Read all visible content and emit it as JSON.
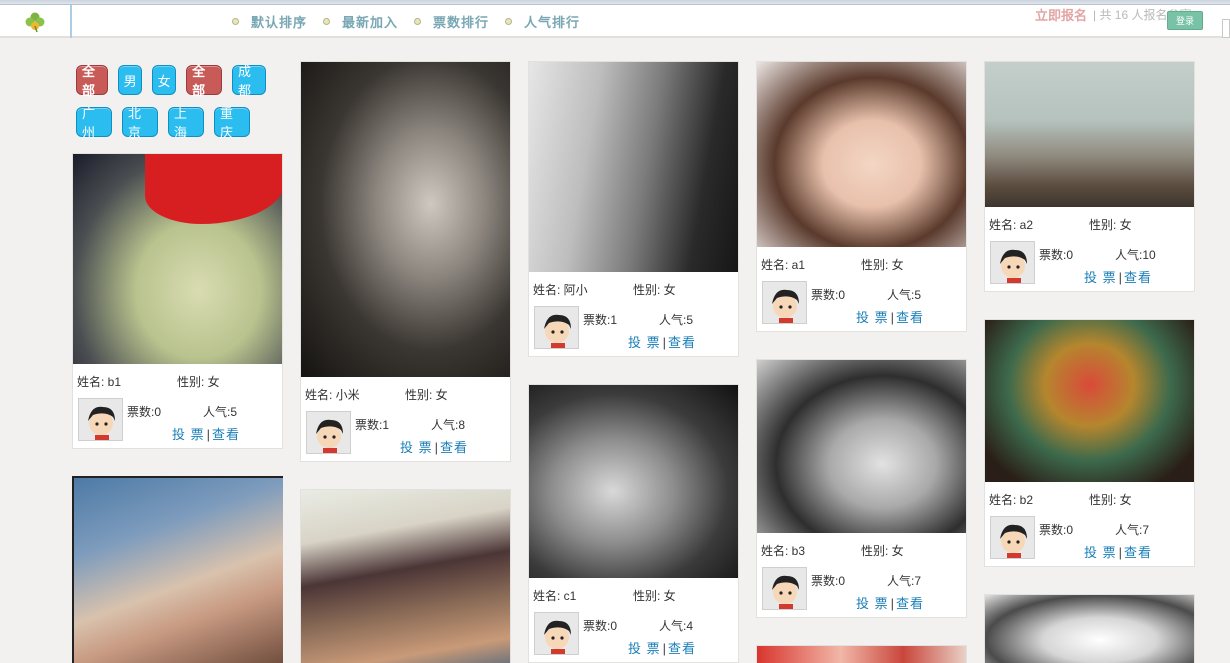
{
  "header": {
    "nav": [
      "默认排序",
      "最新加入",
      "票数排行",
      "人气排行"
    ],
    "signup_link": "立即报名",
    "signup_count": "| 共 16 人报名参赛",
    "login": "登录"
  },
  "filters": {
    "row1": [
      "全部",
      "男",
      "女",
      "全部",
      "成都"
    ],
    "row2": [
      "广州",
      "北京",
      "上海",
      "重庆"
    ]
  },
  "labels": {
    "vote": "投 票",
    "sep": "|",
    "view": "查看"
  },
  "cards": [
    {
      "name": "姓名: b1",
      "gender": "性别: 女",
      "votes": "票数:0",
      "pop": "人气:5"
    },
    {
      "name": "姓名: 小米",
      "gender": "性别: 女",
      "votes": "票数:1",
      "pop": "人气:8"
    },
    {
      "name": "姓名: 阿小",
      "gender": "性别: 女",
      "votes": "票数:1",
      "pop": "人气:5"
    },
    {
      "name": "姓名: c1",
      "gender": "性别: 女",
      "votes": "票数:0",
      "pop": "人气:4"
    },
    {
      "name": "姓名: a1",
      "gender": "性别: 女",
      "votes": "票数:0",
      "pop": "人气:5"
    },
    {
      "name": "姓名: b3",
      "gender": "性别: 女",
      "votes": "票数:0",
      "pop": "人气:7"
    },
    {
      "name": "姓名: a2",
      "gender": "性别: 女",
      "votes": "票数:0",
      "pop": "人气:10"
    },
    {
      "name": "姓名: b2",
      "gender": "性别: 女",
      "votes": "票数:0",
      "pop": "人气:7"
    }
  ]
}
